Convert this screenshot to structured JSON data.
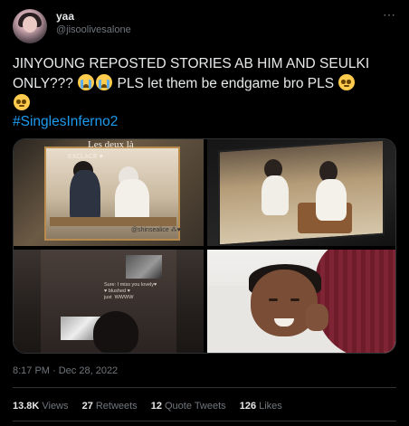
{
  "user": {
    "display_name": "yaa",
    "handle": "@jisoolivesalone"
  },
  "more_icon": "more-options-icon",
  "tweet": {
    "text_part1": "JINYOUNG REPOSTED STORIES AB HIM AND SEULKI ONLY??? ",
    "text_part2": " PLS let them be endgame bro PLS ",
    "emojis": [
      "loudly-crying-face",
      "loudly-crying-face",
      "pleading-face",
      "pleading-face"
    ],
    "hashtag": "#SinglesInferno2"
  },
  "media": {
    "image1": {
      "caption": "Les deux là",
      "caption2": "EXCLACE ♥",
      "sticker": "@shinsealice ⁂♥"
    },
    "image3": {
      "overlay_text": "Sure: I miss you lovely♥\n♥ blushed ♥\njust  WWWW"
    }
  },
  "timestamp": "8:17 PM · Dec 28, 2022",
  "stats": {
    "views_count": "13.8K",
    "views_label": "Views",
    "retweets_count": "27",
    "retweets_label": "Retweets",
    "quotes_count": "12",
    "quotes_label": "Quote Tweets",
    "likes_count": "126",
    "likes_label": "Likes"
  },
  "colors": {
    "background": "#000000",
    "text": "#e7e9ea",
    "muted": "#71767b",
    "link": "#1d9bf0",
    "border": "#2f3336"
  }
}
